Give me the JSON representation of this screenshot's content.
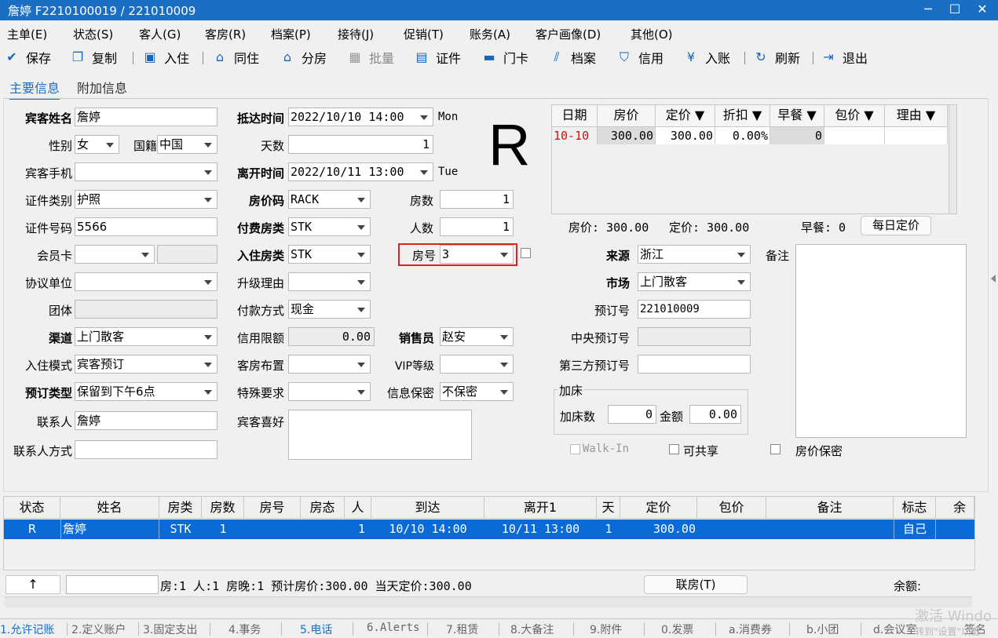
{
  "window": {
    "title": "詹婷 F2210100019 / 221010009",
    "min": "─",
    "max": "☐",
    "close": "✕"
  },
  "menu": [
    "主单(E)",
    "状态(S)",
    "客人(G)",
    "客房(R)",
    "档案(P)",
    "接待(J)",
    "促销(T)",
    "账务(A)",
    "客户画像(D)",
    "其他(O)"
  ],
  "toolbar": {
    "save": "保存",
    "copy": "复制",
    "checkin": "入住",
    "share": "同住",
    "split": "分房",
    "batch": "批量",
    "id": "证件",
    "card": "门卡",
    "archive": "档案",
    "credit": "信用",
    "post": "入账",
    "refresh": "刷新",
    "exit": "退出"
  },
  "icons": {
    "save": "check-circle-icon",
    "copy": "copy-icon",
    "checkin": "person-card-icon",
    "share": "house-person-icon",
    "split": "house-icon",
    "batch": "grid-icon",
    "id": "id-card-icon",
    "card": "card-icon",
    "archive": "bookmark-icon",
    "credit": "shield-icon",
    "post": "yen-icon",
    "refresh": "refresh-icon",
    "exit": "exit-icon"
  },
  "tabs": {
    "main": "主要信息",
    "extra": "附加信息"
  },
  "form": {
    "guest_name_label": "宾客姓名",
    "guest_name": "詹婷",
    "gender_label": "性别",
    "gender": "女",
    "nationality_label": "国籍",
    "nationality": "中国",
    "mobile_label": "宾客手机",
    "mobile": "",
    "id_type_label": "证件类别",
    "id_type": "护照",
    "id_no_label": "证件号码",
    "id_no": "5566",
    "member_label": "会员卡",
    "member": "",
    "agreement_label": "协议单位",
    "agreement": "",
    "group_label": "团体",
    "group": "",
    "channel_label": "渠道",
    "channel": "上门散客",
    "checkin_mode_label": "入住模式",
    "checkin_mode": "宾客预订",
    "booking_type_label": "预订类型",
    "booking_type": "保留到下午6点",
    "contact_label": "联系人",
    "contact": "詹婷",
    "contact_method_label": "联系人方式",
    "contact_method": "",
    "arrival_label": "抵达时间",
    "arrival": "2022/10/10 14:00",
    "arrival_day": "Mon",
    "days_label": "天数",
    "days": "1",
    "departure_label": "离开时间",
    "departure": "2022/10/11 13:00",
    "departure_day": "Tue",
    "rate_code_label": "房价码",
    "rate_code": "RACK",
    "rooms_label": "房数",
    "rooms": "1",
    "pay_type_label": "付费房类",
    "pay_type": "STK",
    "persons_label": "人数",
    "persons": "1",
    "stay_type_label": "入住房类",
    "stay_type": "STK",
    "room_no_label": "房号",
    "room_no": "3",
    "upgrade_label": "升级理由",
    "upgrade": "",
    "payment_label": "付款方式",
    "payment": "现金",
    "credit_label": "信用限额",
    "credit": "0.00",
    "sales_label": "销售员",
    "sales": "赵安",
    "layout_label": "客房布置",
    "layout": "",
    "vip_label": "VIP等级",
    "vip": "",
    "special_label": "特殊要求",
    "special": "",
    "privacy_label": "信息保密",
    "privacy": "不保密",
    "pref_label": "宾客喜好",
    "pref": "",
    "status_big": "R",
    "source_label": "来源",
    "source": "浙江",
    "remark_label": "备注",
    "market_label": "市场",
    "market": "上门散客",
    "booking_no_label": "预订号",
    "booking_no": "221010009",
    "central_no_label": "中央预订号",
    "central_no": "",
    "third_no_label": "第三方预订号",
    "third_no": "",
    "extra_bed_group": "加床",
    "extra_bed_count_label": "加床数",
    "extra_bed_count": "0",
    "amount_label": "金额",
    "amount": "0.00",
    "walkin_label": "Walk-In",
    "shareable_label": "可共享",
    "rate_secret_label": "房价保密"
  },
  "rate_grid": {
    "headers": [
      "日期",
      "房价",
      "定价 ▼",
      "折扣 ▼",
      "早餐 ▼",
      "包价 ▼",
      "理由 ▼"
    ],
    "rows": [
      [
        "10-10",
        "300.00",
        "300.00",
        "0.00%",
        "0",
        "",
        ""
      ]
    ],
    "summary": {
      "rate": "房价: 300.00",
      "list": "定价: 300.00",
      "breakfast": "早餐: 0",
      "daily_btn": "每日定价"
    }
  },
  "room_grid": {
    "headers": [
      "状态",
      "姓名",
      "房类",
      "房数",
      "房号",
      "房态",
      "人",
      "到达",
      "离开1",
      "天",
      "定价",
      "包价",
      "备注",
      "标志",
      "余额"
    ],
    "rows": [
      [
        "R",
        "詹婷",
        "STK",
        "1",
        "",
        "",
        "1",
        "10/10 14:00",
        "10/11 13:00",
        "1",
        "300.00",
        "",
        "",
        "自己",
        ""
      ]
    ],
    "footer": {
      "up": "↑",
      "summary": "房:1 人:1 房晚:1 预计房价:300.00 当天定价:300.00",
      "link_btn": "联房(T)",
      "balance": "余额:"
    }
  },
  "bottom_tabs": [
    "1.允许记账",
    "2.定义账户",
    "3.固定支出",
    "4.事务",
    "5.电话",
    "6.Alerts",
    "7.租赁",
    "8.大备注",
    "9.附件",
    "0.发票",
    "a.消费券",
    "b.小团",
    "d.会议室",
    "签名"
  ],
  "watermark": {
    "line1": "激活 Windo",
    "line2": "转到\"设置\"以激"
  },
  "colors": {
    "accent": "#1a6fc4",
    "selected_row": "#0a6ad8",
    "highlight_border": "#e02020"
  }
}
